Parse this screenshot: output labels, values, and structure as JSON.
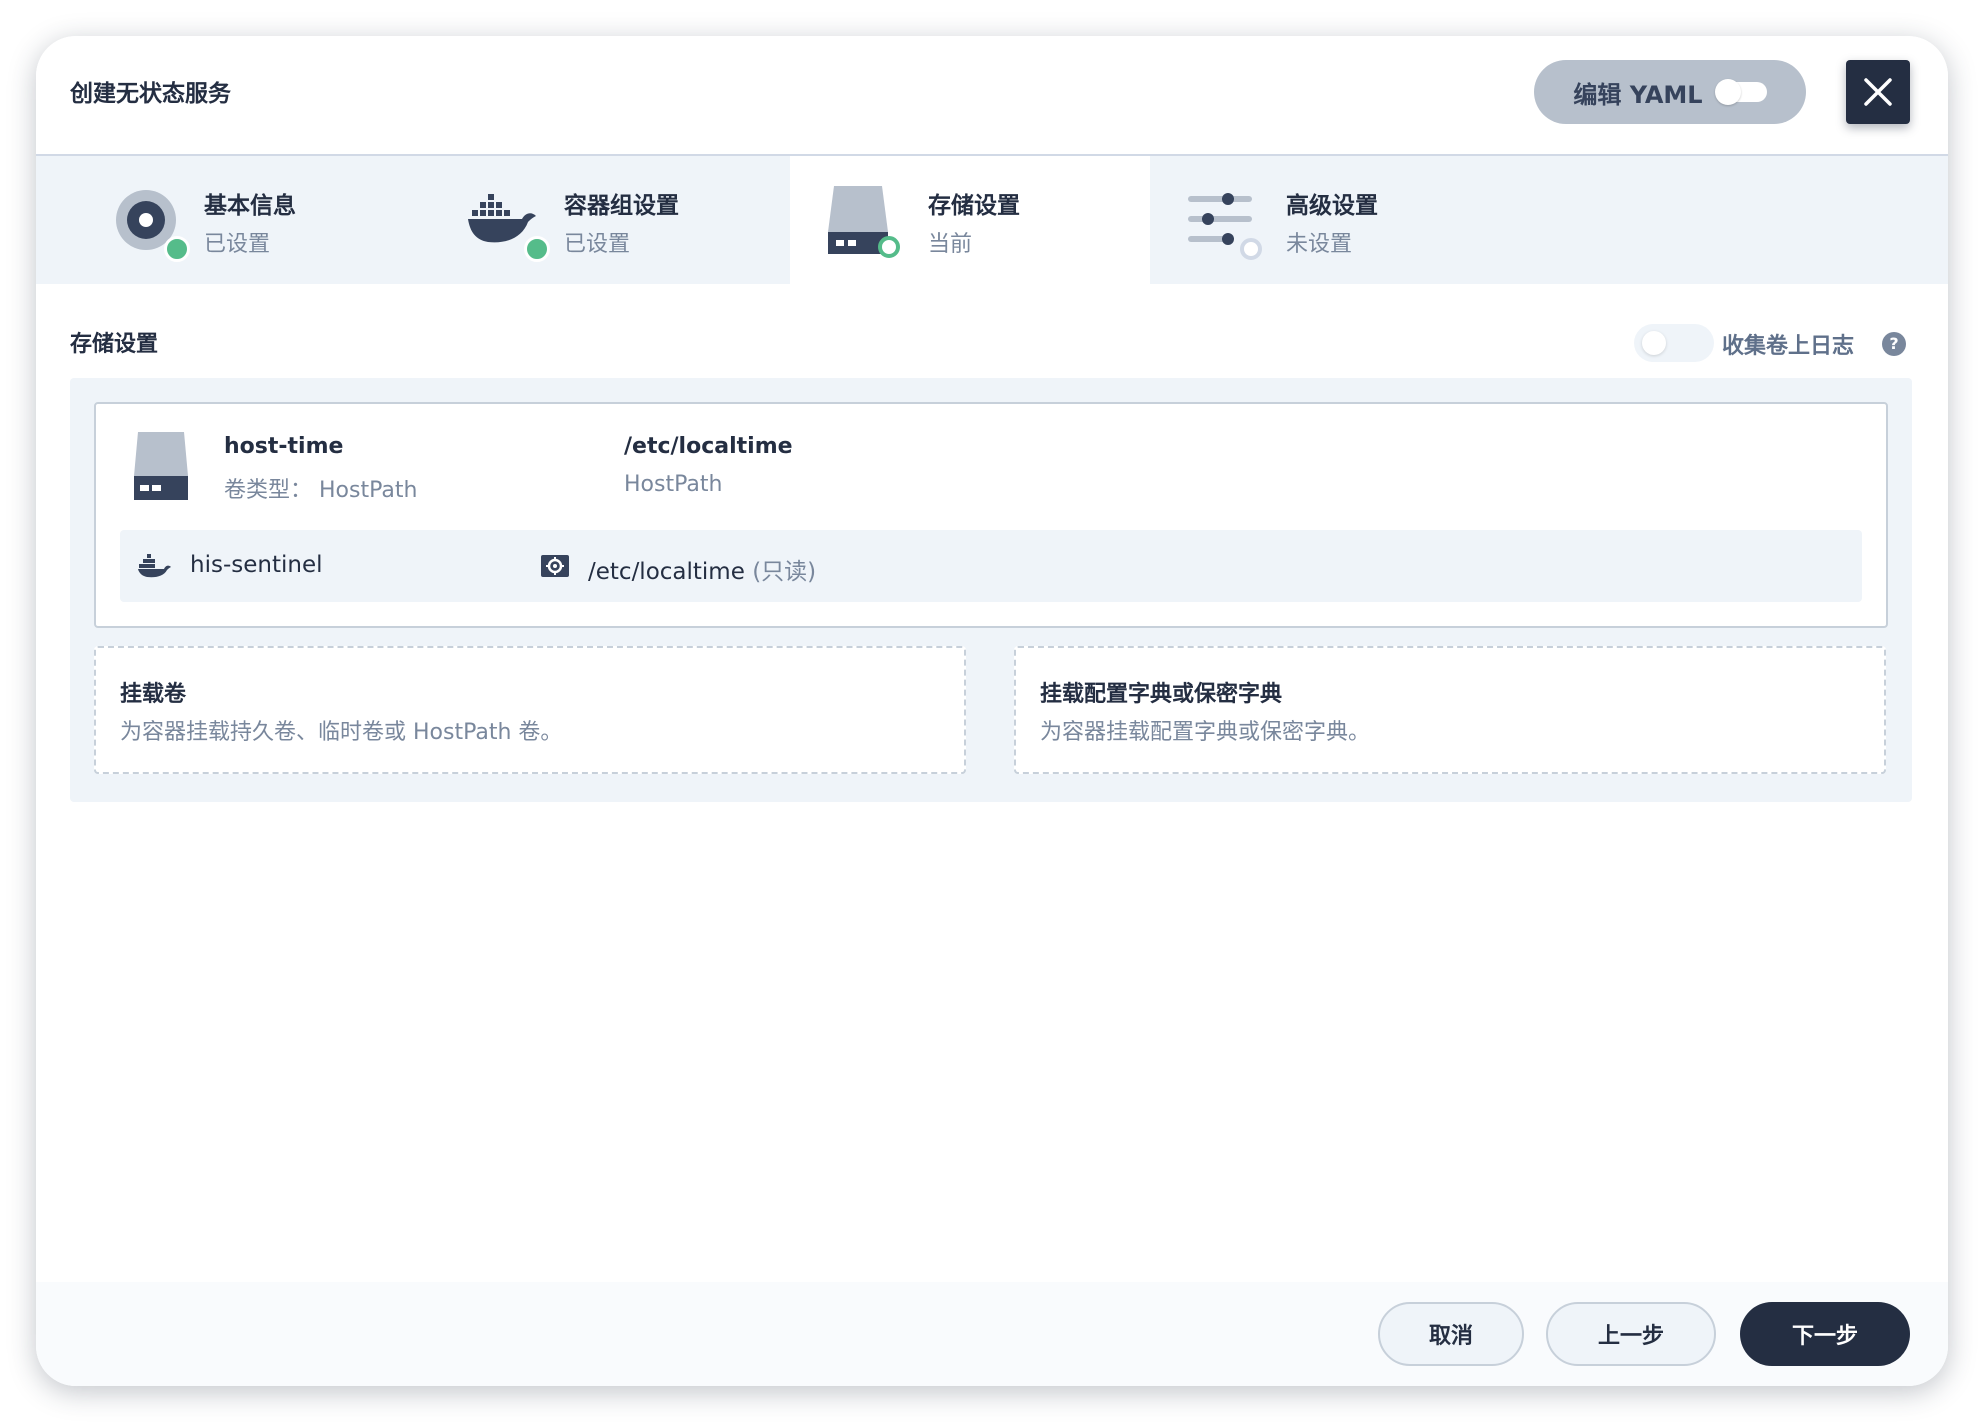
{
  "header": {
    "title": "创建无状态服务",
    "yaml_label": "编辑 YAML"
  },
  "steps": [
    {
      "name": "基本信息",
      "status": "已设置",
      "icon": "disc-icon"
    },
    {
      "name": "容器组设置",
      "status": "已设置",
      "icon": "docker-icon"
    },
    {
      "name": "存储设置",
      "status": "当前",
      "icon": "storage-icon"
    },
    {
      "name": "高级设置",
      "status": "未设置",
      "icon": "sliders-icon"
    }
  ],
  "main": {
    "section_title": "存储设置",
    "collect_logs_label": "收集卷上日志",
    "help_symbol": "?"
  },
  "volume": {
    "name": "host-time",
    "type_text": "卷类型： HostPath",
    "path": "/etc/localtime",
    "path_type": "HostPath",
    "mount": {
      "container": "his-sentinel",
      "mount_path": "/etc/localtime",
      "mode": "(只读)"
    }
  },
  "add_cards": [
    {
      "title": "挂载卷",
      "desc": "为容器挂载持久卷、临时卷或 HostPath 卷。"
    },
    {
      "title": "挂载配置字典或保密字典",
      "desc": "为容器挂载配置字典或保密字典。"
    }
  ],
  "footer": {
    "cancel": "取消",
    "prev": "上一步",
    "next": "下一步"
  },
  "colors": {
    "primary_dark": "#242e42",
    "success": "#55bc8a",
    "bg_light": "#eff4f9",
    "text_secondary": "#79879c"
  }
}
